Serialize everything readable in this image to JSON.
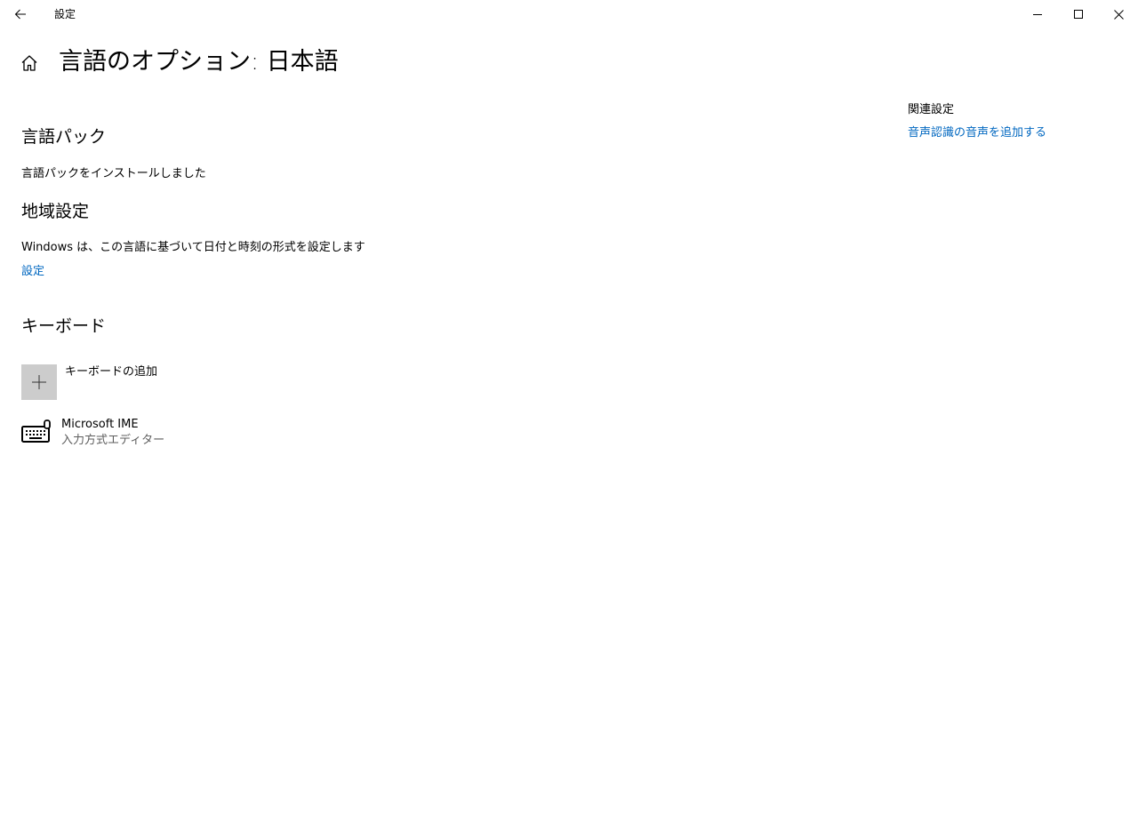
{
  "window": {
    "app_title": "設定",
    "controls": {
      "minimize_icon": "minimize-icon",
      "maximize_icon": "maximize-icon",
      "close_icon": "close-icon"
    }
  },
  "header": {
    "title": "言語のオプション: 日本語",
    "home_icon": "home-icon",
    "back_icon": "back-arrow-icon"
  },
  "language_pack": {
    "title": "言語パック",
    "status": "言語パックをインストールしました"
  },
  "regional": {
    "title": "地域設定",
    "description": "Windows は、この言語に基づいて日付と時刻の形式を設定します",
    "link_label": "設定"
  },
  "keyboard": {
    "title": "キーボード",
    "add_label": "キーボードの追加",
    "items": [
      {
        "name": "Microsoft IME",
        "subtitle": "入力方式エディター",
        "icon": "keyboard-icon"
      }
    ]
  },
  "related": {
    "title": "関連設定",
    "links": [
      "音声認識の音声を追加する"
    ]
  },
  "colors": {
    "accent_link": "#0067c0",
    "add_button_bg": "#cccccc",
    "secondary_text": "#5d5d5d"
  }
}
